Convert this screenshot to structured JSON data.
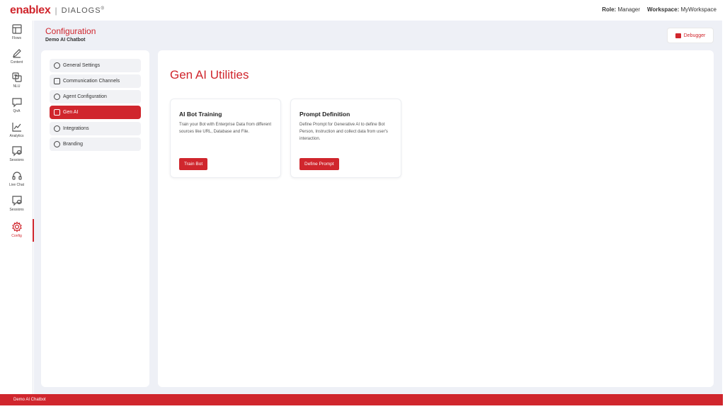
{
  "header": {
    "brand": "enablex",
    "separator": "|",
    "product": "DIALOGS",
    "product_mark": "®",
    "role_label": "Role:",
    "role_value": "Manager",
    "workspace_label": "Workspace:",
    "workspace_value": "MyWorkspace"
  },
  "rail": {
    "items": [
      {
        "label": "Flows",
        "icon": "flows-icon"
      },
      {
        "label": "Content",
        "icon": "pencil-icon"
      },
      {
        "label": "NLU",
        "icon": "translate-icon"
      },
      {
        "label": "QnA",
        "icon": "chat-icon"
      },
      {
        "label": "Analytics",
        "icon": "chart-line-icon"
      },
      {
        "label": "Sessions",
        "icon": "session-icon"
      },
      {
        "label": "Live Chat",
        "icon": "headset-icon"
      },
      {
        "label": "Sessions",
        "icon": "session-icon"
      },
      {
        "label": "Config",
        "icon": "gear-icon"
      }
    ],
    "active_index": 8
  },
  "breadcrumb": {
    "title": "Configuration",
    "subtitle": "Demo AI Chatbot"
  },
  "debugger": {
    "label": "Debugger"
  },
  "settings_menu": {
    "items": [
      {
        "label": "General Settings",
        "icon": "gear-icon"
      },
      {
        "label": "Communication Channels",
        "icon": "channel-icon"
      },
      {
        "label": "Agent Configuration",
        "icon": "agent-icon"
      },
      {
        "label": "Gen AI",
        "icon": "ai-icon"
      },
      {
        "label": "Integrations",
        "icon": "integrations-icon"
      },
      {
        "label": "Branding",
        "icon": "branding-icon"
      }
    ],
    "active_index": 3
  },
  "content": {
    "title": "Gen AI Utilities",
    "cards": [
      {
        "title": "AI Bot Training",
        "description": "Train your Bot with Enterprise Data from different sources like URL, Database and File.",
        "button": "Train Bot"
      },
      {
        "title": "Prompt Definition",
        "description": "Define Prompt for Generative AI to define Bot Person, Instruction and collect data from user's interaction.",
        "button": "Define Prompt"
      }
    ]
  },
  "footer": {
    "text": "Demo AI Chatbot"
  },
  "colors": {
    "accent": "#d0262d",
    "background": "#eef0f6"
  }
}
